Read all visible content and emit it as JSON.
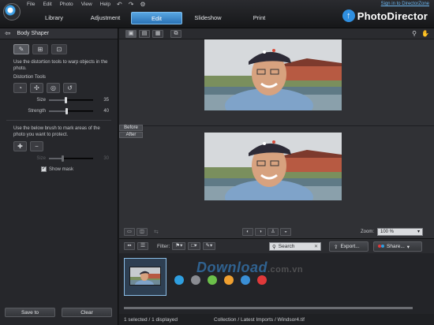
{
  "app": {
    "menu": [
      "File",
      "Edit",
      "Photo",
      "View",
      "Help"
    ],
    "toolbar_icons": [
      "↶",
      "↷",
      "⚙"
    ],
    "tabs": [
      {
        "label": "Library",
        "active": false
      },
      {
        "label": "Adjustment",
        "active": false
      },
      {
        "label": "Edit",
        "active": true
      },
      {
        "label": "Slideshow",
        "active": false
      },
      {
        "label": "Print",
        "active": false
      }
    ],
    "signin": "Sign in to DirectorZone",
    "brand": "PhotoDirector",
    "accent": "#3b8ed6"
  },
  "panel": {
    "title": "Body Shaper",
    "description": "Use the distortion tools to warp objects in the photo.",
    "distortion_label": "Distortion Tools",
    "size_label": "Size",
    "size_value": "35",
    "strength_label": "Strength",
    "strength_value": "40",
    "brush_description": "Use the below brush to mark areas of the photo you want to protect.",
    "brush_size_label": "Size",
    "brush_size_value": "30",
    "show_mask_label": "Show mask",
    "save_label": "Save to",
    "clear_label": "Clear"
  },
  "viewer": {
    "before_label": "Before",
    "after_label": "After",
    "zoom_label": "Zoom:",
    "zoom_value": "100 %"
  },
  "library": {
    "filter_label": "Filter:",
    "search_placeholder": "Search",
    "export_label": "Export...",
    "share_label": "Share...",
    "status_selected": "1 selected",
    "status_displayed": "1 displayed",
    "status_path": "Collection / Latest Imports / Windsor4.tif",
    "color_labels": [
      "#2f9fe0",
      "#8a8c92",
      "#6cc04a",
      "#f0a030",
      "#3a8fd6",
      "#e0393a"
    ],
    "watermark": "Download",
    "watermark_tld": ".com.vn"
  }
}
